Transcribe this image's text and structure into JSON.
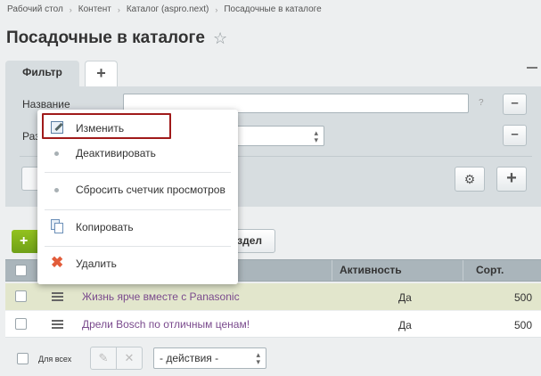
{
  "breadcrumb": [
    "Рабочий стол",
    "Контент",
    "Каталог (aspro.next)",
    "Посадочные в каталоге"
  ],
  "page_title": "Посадочные в каталоге",
  "filter": {
    "tab_label": "Фильтр",
    "add_tab_symbol": "+",
    "field_name_label": "Название",
    "field_section_label": "Раз",
    "help": "?",
    "name_value": "",
    "section_value": ""
  },
  "toolbar": {
    "add_symbol": "+",
    "section_button_tail": "здел"
  },
  "context_menu": {
    "items": [
      "Изменить",
      "Деактивировать",
      "Сбросить счетчик просмотров",
      "Копировать",
      "Удалить"
    ]
  },
  "grid": {
    "columns": [
      "Активность",
      "Сорт."
    ],
    "rows": [
      {
        "name": "Жизнь ярче вместе с Panasonic",
        "active": "Да",
        "sort": "500"
      },
      {
        "name": "Дрели Bosch по отличным ценам!",
        "active": "Да",
        "sort": "500"
      }
    ]
  },
  "footer": {
    "for_all": "Для всех",
    "actions_select": "- действия -"
  },
  "colors": {
    "accent_green": "#7fb21c",
    "link_purple": "#7a4a8d",
    "highlight_border": "#a01a1a",
    "header_bg": "#aab5bb",
    "selected_row_bg": "#e2e6cc"
  }
}
